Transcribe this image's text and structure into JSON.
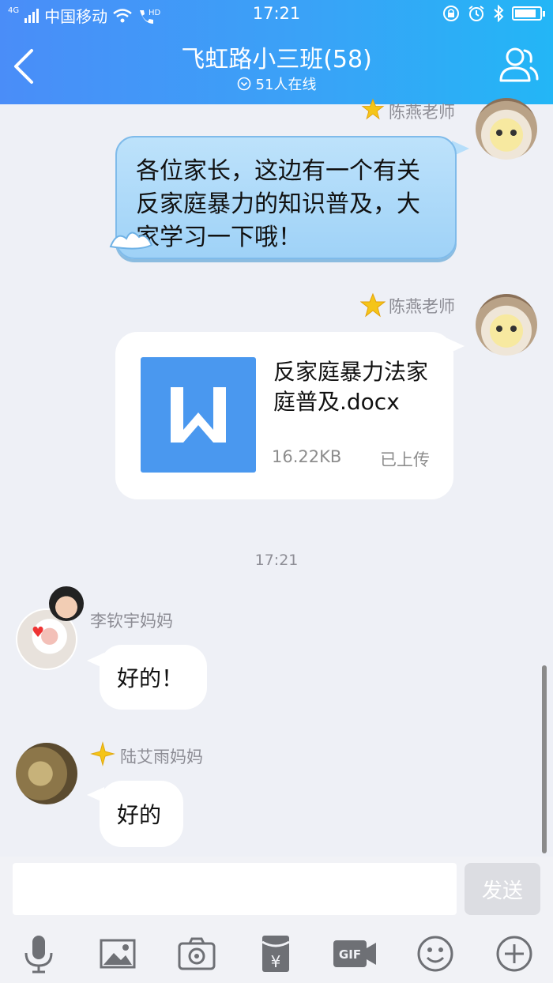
{
  "status_bar": {
    "network": "4G",
    "carrier": "中国移动",
    "time": "17:21"
  },
  "header": {
    "title": "飞虹路小三班(58)",
    "online": "51人在线"
  },
  "messages": {
    "m1_sender": "陈燕老师",
    "m1_text": "各位家长，这边有一个有关反家庭暴力的知识普及，大家学习一下哦！",
    "m2_sender": "陈燕老师",
    "m2_file_name": "反家庭暴力法家庭普及.docx",
    "m2_file_size": "16.22KB",
    "m2_file_status": "已上传",
    "time_separator": "17:21",
    "m3_sender": "李钦宇妈妈",
    "m3_text": "好的！",
    "m4_sender": "陆艾雨妈妈",
    "m4_text": "好的"
  },
  "input": {
    "placeholder": "",
    "send_label": "发送"
  },
  "toolbar_icons": [
    "microphone-icon",
    "image-icon",
    "camera-icon",
    "red-packet-icon",
    "gif-icon",
    "emoji-icon",
    "plus-icon"
  ],
  "colors": {
    "header_start": "#4a8df8",
    "header_end": "#23b6f6",
    "file_icon": "#4a98ef",
    "star": "#f5c518"
  }
}
